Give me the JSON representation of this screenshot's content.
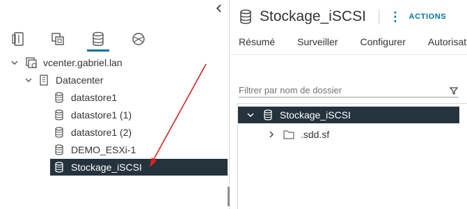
{
  "nav": {
    "tabs": [
      {
        "icon": "hosts-and-clusters-icon"
      },
      {
        "icon": "vms-and-templates-icon"
      },
      {
        "icon": "storage-icon",
        "active": true
      },
      {
        "icon": "networking-icon"
      }
    ],
    "tree": [
      {
        "label": "vcenter.gabriel.lan",
        "icon": "vcenter-icon",
        "expanded": true
      },
      {
        "label": "Datacenter",
        "icon": "datacenter-icon",
        "expanded": true
      },
      {
        "label": "datastore1",
        "icon": "datastore-icon"
      },
      {
        "label": "datastore1 (1)",
        "icon": "datastore-icon"
      },
      {
        "label": "datastore1 (2)",
        "icon": "datastore-icon"
      },
      {
        "label": "DEMO_ESXi-1",
        "icon": "datastore-icon"
      },
      {
        "label": "Stockage_iSCSI",
        "icon": "datastore-icon",
        "selected": true
      }
    ]
  },
  "header": {
    "title": "Stockage_iSCSI",
    "actions_label": "ACTIONS"
  },
  "tabs": [
    "Résumé",
    "Surveiller",
    "Configurer",
    "Autorisations"
  ],
  "filter": {
    "placeholder": "Filtrer par nom de dossier",
    "value": ""
  },
  "folder_tree": [
    {
      "label": "Stockage_iSCSI",
      "expanded": true,
      "selected": true
    },
    {
      "label": ".sdd.sf",
      "expanded": false
    }
  ],
  "colors": {
    "accent": "#0072a3",
    "selected_bg": "#25333d",
    "annotation_arrow": "#e02020"
  }
}
